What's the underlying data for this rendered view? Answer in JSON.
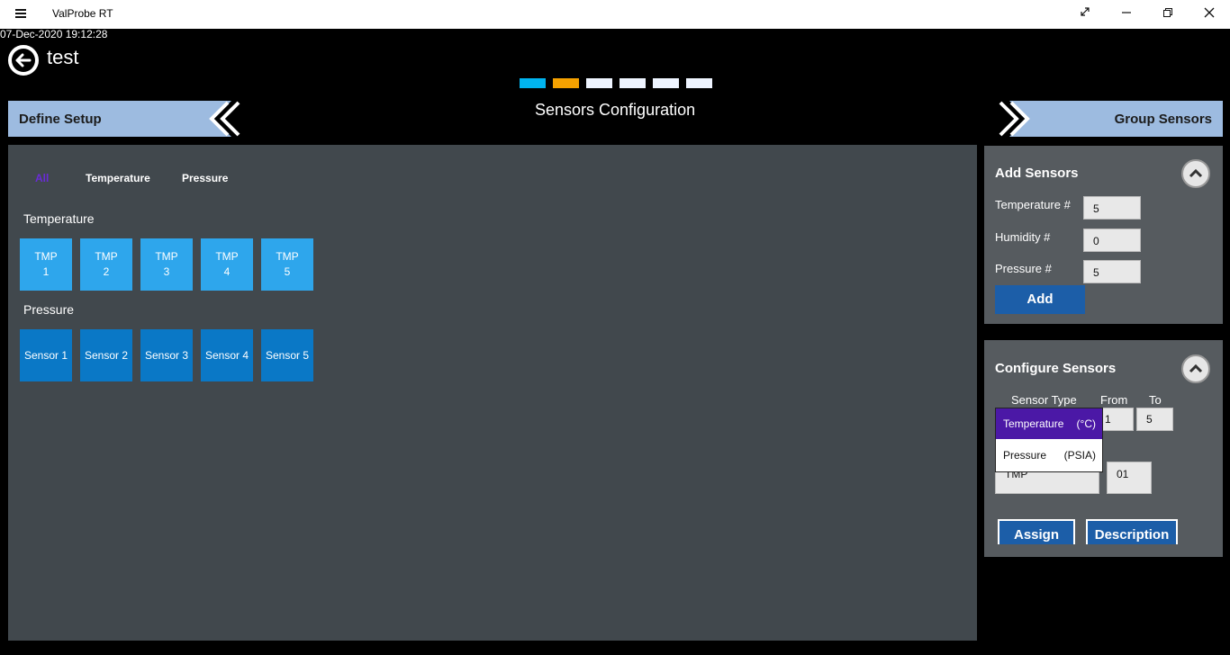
{
  "window": {
    "app_title": "ValProbe RT",
    "controls": [
      "restore-icon",
      "minimize-icon",
      "maximize-icon",
      "close-icon"
    ]
  },
  "timestamp": "07-Dec-2020 19:12:28",
  "page_title": "test",
  "steps": {
    "colors": [
      "#00b4f0",
      "#f5a100",
      "#eef4ff",
      "#eef4ff",
      "#eef4ff",
      "#eef4ff"
    ],
    "current": 2
  },
  "nav": {
    "prev_label": "Define Setup",
    "next_label": "Group Sensors",
    "screen_title": "Sensors Configuration"
  },
  "filters": {
    "all": "All",
    "temperature": "Temperature",
    "pressure": "Pressure",
    "active_color": "#6a2bd8"
  },
  "groups": {
    "temperature": {
      "label": "Temperature",
      "tiles": [
        {
          "line1": "TMP",
          "line2": "1"
        },
        {
          "line1": "TMP",
          "line2": "2"
        },
        {
          "line1": "TMP",
          "line2": "3"
        },
        {
          "line1": "TMP",
          "line2": "4"
        },
        {
          "line1": "TMP",
          "line2": "5"
        }
      ]
    },
    "pressure": {
      "label": "Pressure",
      "tiles": [
        "Sensor 1",
        "Sensor 2",
        "Sensor 3",
        "Sensor 4",
        "Sensor 5"
      ]
    }
  },
  "add_sensors": {
    "title": "Add Sensors",
    "temperature_label": "Temperature #",
    "temperature_value": "5",
    "humidity_label": "Humidity #",
    "humidity_value": "0",
    "pressure_label": "Pressure #",
    "pressure_value": "5",
    "add_button": "Add"
  },
  "configure_sensors": {
    "title": "Configure Sensors",
    "sensor_type_header": "Sensor Type",
    "from_header": "From",
    "to_header": "To",
    "from_value": "1",
    "to_value": "5",
    "dropdown": {
      "selected": {
        "name": "Temperature",
        "unit": "(°C)"
      },
      "other": {
        "name": "Pressure",
        "unit": "(PSIA)"
      }
    },
    "prefix_value": "TMP",
    "start_value": "01",
    "assign_button": "Assign",
    "description_button": "Description"
  }
}
